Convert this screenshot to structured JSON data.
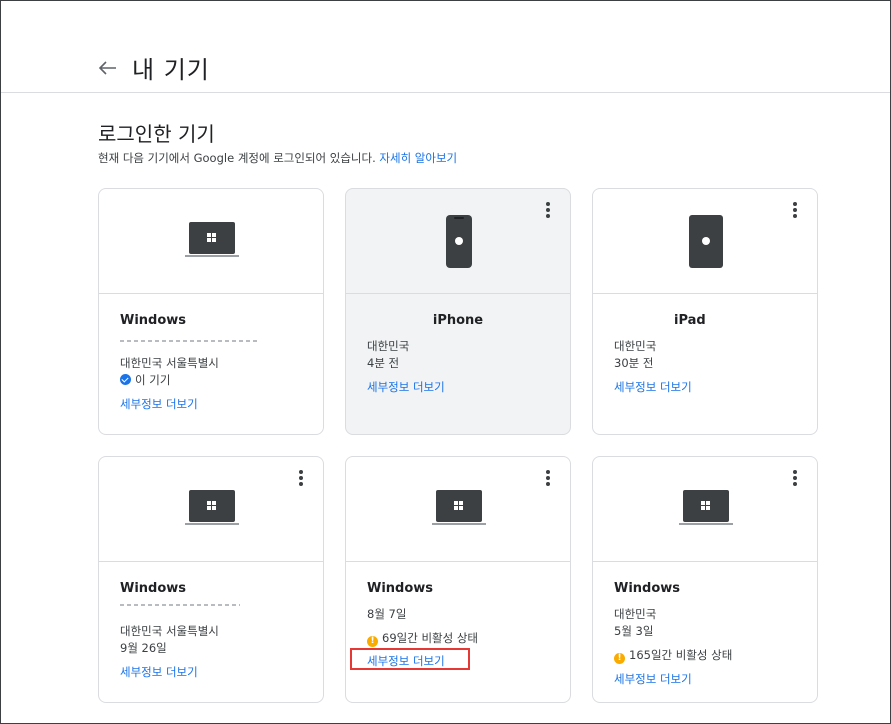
{
  "header": {
    "back_icon": "arrow-left-icon",
    "title": "내 기기"
  },
  "section": {
    "title": "로그인한 기기",
    "description": "현재 다음 기기에서 Google 계정에 로그인되어 있습니다.",
    "learn_more": "자세히 알아보기"
  },
  "devices": [
    {
      "icon": "laptop-windows-icon",
      "name": "Windows",
      "location": "대한민국 서울특별시",
      "this_device": "이 기기",
      "details_link": "세부정보 더보기"
    },
    {
      "icon": "iphone-icon",
      "name": "iPhone",
      "location": "대한민국",
      "time": "4분 전",
      "details_link": "세부정보 더보기"
    },
    {
      "icon": "ipad-icon",
      "name": "iPad",
      "location": "대한민국",
      "time": "30분 전",
      "details_link": "세부정보 더보기"
    },
    {
      "icon": "laptop-windows-icon",
      "name": "Windows",
      "location": "대한민국 서울특별시",
      "time": "9월 26일",
      "details_link": "세부정보 더보기"
    },
    {
      "icon": "laptop-windows-icon",
      "name": "Windows",
      "time": "8월 7일",
      "inactive": "69일간 비활성 상태",
      "details_link": "세부정보 더보기"
    },
    {
      "icon": "laptop-windows-icon",
      "name": "Windows",
      "location": "대한민국",
      "time": "5월 3일",
      "inactive": "165일간 비활성 상태",
      "details_link": "세부정보 더보기"
    }
  ],
  "colors": {
    "link": "#1a73e8",
    "warning": "#f9ab00",
    "check": "#1a73e8",
    "highlight": "#e53935"
  }
}
